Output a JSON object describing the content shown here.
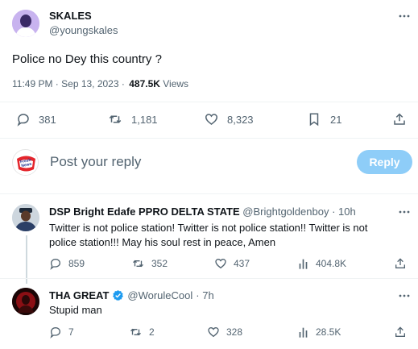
{
  "tweet": {
    "author_name": "SKALES",
    "author_handle": "@youngskales",
    "text": "Police no Dey this country ?",
    "time": "11:49 PM · Sep 13, 2023 ·",
    "views_count": "487.5K",
    "views_label": "Views",
    "stats": {
      "replies": "381",
      "retweets": "1,181",
      "likes": "8,323",
      "bookmarks": "21"
    }
  },
  "composer": {
    "placeholder": "Post your reply",
    "reply_button": "Reply",
    "avatar_logo_text": "Fresh News"
  },
  "replies": [
    {
      "author_name": "DSP Bright Edafe PPRO DELTA STATE",
      "author_handle": "@Brightgoldenboy",
      "time": "· 10h",
      "text_line1": "Twitter is not police station!  Twitter is not police station!! Twitter is not",
      "text_line2": "police station!!! May his soul rest in peace, Amen",
      "stats": {
        "replies": "859",
        "retweets": "352",
        "likes": "437",
        "views": "404.8K"
      }
    },
    {
      "author_name": "THA GREAT",
      "author_handle": "@WoruleCool",
      "time": "· 7h",
      "text": "Stupid man",
      "stats": {
        "replies": "7",
        "retweets": "2",
        "likes": "328",
        "views": "28.5K"
      }
    }
  ],
  "colors": {
    "accent": "#1d9bf0",
    "reply_button_disabled": "#8ecdf8",
    "verified": "#1d9bf0"
  }
}
